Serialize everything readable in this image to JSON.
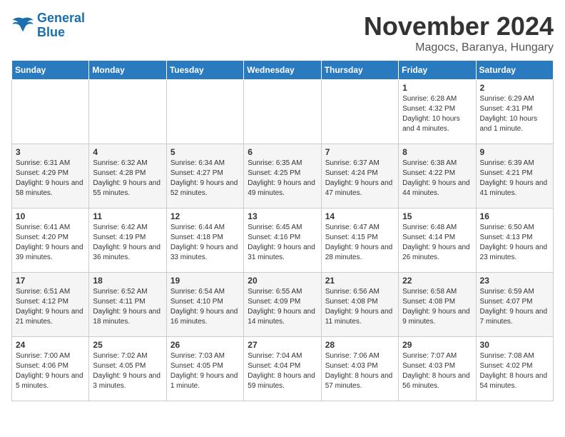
{
  "logo": {
    "line1": "General",
    "line2": "Blue"
  },
  "header": {
    "month": "November 2024",
    "location": "Magocs, Baranya, Hungary"
  },
  "days_of_week": [
    "Sunday",
    "Monday",
    "Tuesday",
    "Wednesday",
    "Thursday",
    "Friday",
    "Saturday"
  ],
  "weeks": [
    [
      {
        "day": "",
        "info": ""
      },
      {
        "day": "",
        "info": ""
      },
      {
        "day": "",
        "info": ""
      },
      {
        "day": "",
        "info": ""
      },
      {
        "day": "",
        "info": ""
      },
      {
        "day": "1",
        "info": "Sunrise: 6:28 AM\nSunset: 4:32 PM\nDaylight: 10 hours and 4 minutes."
      },
      {
        "day": "2",
        "info": "Sunrise: 6:29 AM\nSunset: 4:31 PM\nDaylight: 10 hours and 1 minute."
      }
    ],
    [
      {
        "day": "3",
        "info": "Sunrise: 6:31 AM\nSunset: 4:29 PM\nDaylight: 9 hours and 58 minutes."
      },
      {
        "day": "4",
        "info": "Sunrise: 6:32 AM\nSunset: 4:28 PM\nDaylight: 9 hours and 55 minutes."
      },
      {
        "day": "5",
        "info": "Sunrise: 6:34 AM\nSunset: 4:27 PM\nDaylight: 9 hours and 52 minutes."
      },
      {
        "day": "6",
        "info": "Sunrise: 6:35 AM\nSunset: 4:25 PM\nDaylight: 9 hours and 49 minutes."
      },
      {
        "day": "7",
        "info": "Sunrise: 6:37 AM\nSunset: 4:24 PM\nDaylight: 9 hours and 47 minutes."
      },
      {
        "day": "8",
        "info": "Sunrise: 6:38 AM\nSunset: 4:22 PM\nDaylight: 9 hours and 44 minutes."
      },
      {
        "day": "9",
        "info": "Sunrise: 6:39 AM\nSunset: 4:21 PM\nDaylight: 9 hours and 41 minutes."
      }
    ],
    [
      {
        "day": "10",
        "info": "Sunrise: 6:41 AM\nSunset: 4:20 PM\nDaylight: 9 hours and 39 minutes."
      },
      {
        "day": "11",
        "info": "Sunrise: 6:42 AM\nSunset: 4:19 PM\nDaylight: 9 hours and 36 minutes."
      },
      {
        "day": "12",
        "info": "Sunrise: 6:44 AM\nSunset: 4:18 PM\nDaylight: 9 hours and 33 minutes."
      },
      {
        "day": "13",
        "info": "Sunrise: 6:45 AM\nSunset: 4:16 PM\nDaylight: 9 hours and 31 minutes."
      },
      {
        "day": "14",
        "info": "Sunrise: 6:47 AM\nSunset: 4:15 PM\nDaylight: 9 hours and 28 minutes."
      },
      {
        "day": "15",
        "info": "Sunrise: 6:48 AM\nSunset: 4:14 PM\nDaylight: 9 hours and 26 minutes."
      },
      {
        "day": "16",
        "info": "Sunrise: 6:50 AM\nSunset: 4:13 PM\nDaylight: 9 hours and 23 minutes."
      }
    ],
    [
      {
        "day": "17",
        "info": "Sunrise: 6:51 AM\nSunset: 4:12 PM\nDaylight: 9 hours and 21 minutes."
      },
      {
        "day": "18",
        "info": "Sunrise: 6:52 AM\nSunset: 4:11 PM\nDaylight: 9 hours and 18 minutes."
      },
      {
        "day": "19",
        "info": "Sunrise: 6:54 AM\nSunset: 4:10 PM\nDaylight: 9 hours and 16 minutes."
      },
      {
        "day": "20",
        "info": "Sunrise: 6:55 AM\nSunset: 4:09 PM\nDaylight: 9 hours and 14 minutes."
      },
      {
        "day": "21",
        "info": "Sunrise: 6:56 AM\nSunset: 4:08 PM\nDaylight: 9 hours and 11 minutes."
      },
      {
        "day": "22",
        "info": "Sunrise: 6:58 AM\nSunset: 4:08 PM\nDaylight: 9 hours and 9 minutes."
      },
      {
        "day": "23",
        "info": "Sunrise: 6:59 AM\nSunset: 4:07 PM\nDaylight: 9 hours and 7 minutes."
      }
    ],
    [
      {
        "day": "24",
        "info": "Sunrise: 7:00 AM\nSunset: 4:06 PM\nDaylight: 9 hours and 5 minutes."
      },
      {
        "day": "25",
        "info": "Sunrise: 7:02 AM\nSunset: 4:05 PM\nDaylight: 9 hours and 3 minutes."
      },
      {
        "day": "26",
        "info": "Sunrise: 7:03 AM\nSunset: 4:05 PM\nDaylight: 9 hours and 1 minute."
      },
      {
        "day": "27",
        "info": "Sunrise: 7:04 AM\nSunset: 4:04 PM\nDaylight: 8 hours and 59 minutes."
      },
      {
        "day": "28",
        "info": "Sunrise: 7:06 AM\nSunset: 4:03 PM\nDaylight: 8 hours and 57 minutes."
      },
      {
        "day": "29",
        "info": "Sunrise: 7:07 AM\nSunset: 4:03 PM\nDaylight: 8 hours and 56 minutes."
      },
      {
        "day": "30",
        "info": "Sunrise: 7:08 AM\nSunset: 4:02 PM\nDaylight: 8 hours and 54 minutes."
      }
    ]
  ]
}
